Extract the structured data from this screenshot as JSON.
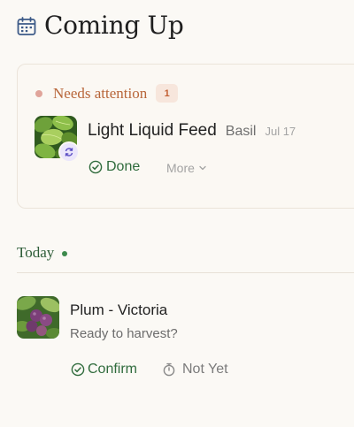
{
  "header": {
    "title": "Coming Up",
    "icon": "calendar-icon"
  },
  "attention": {
    "label": "Needs attention",
    "count": "1",
    "task": {
      "name": "Light Liquid Feed",
      "plant": "Basil",
      "date": "Jul 17",
      "thumbnail": "basil-photo",
      "badge_icon": "repeat-icon",
      "done_label": "Done",
      "more_label": "More"
    }
  },
  "today": {
    "label": "Today",
    "item": {
      "name": "Plum - Victoria",
      "subtitle": "Ready to harvest?",
      "thumbnail": "plum-photo",
      "confirm_label": "Confirm",
      "notyet_label": "Not Yet"
    }
  },
  "colors": {
    "background": "#fbf9f5",
    "attention_accent": "#b8663a",
    "success": "#2f6b3c",
    "today_green": "#2d5c37"
  }
}
